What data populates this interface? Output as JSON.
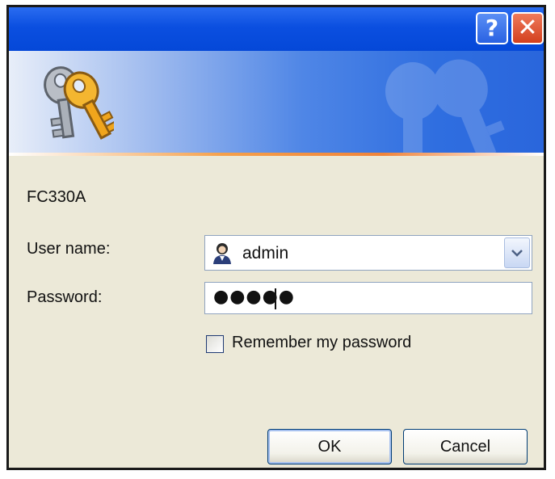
{
  "titlebar": {
    "help_label": "?",
    "close_label": "✕"
  },
  "banner": {
    "icon": "keys-icon",
    "watermark_icon": "keys-watermark-icon"
  },
  "device_name": "FC330A",
  "username": {
    "label": "User name:",
    "value": "admin",
    "icon": "user-icon"
  },
  "password": {
    "label": "Password:",
    "masked_value": "●●●●●"
  },
  "remember": {
    "label": "Remember my password",
    "checked": false
  },
  "buttons": {
    "ok_label": "OK",
    "cancel_label": "Cancel"
  },
  "colors": {
    "titlebar": "#0b4fe0",
    "dialog_background": "#ece9d8",
    "accent_line": "#f0843a"
  }
}
